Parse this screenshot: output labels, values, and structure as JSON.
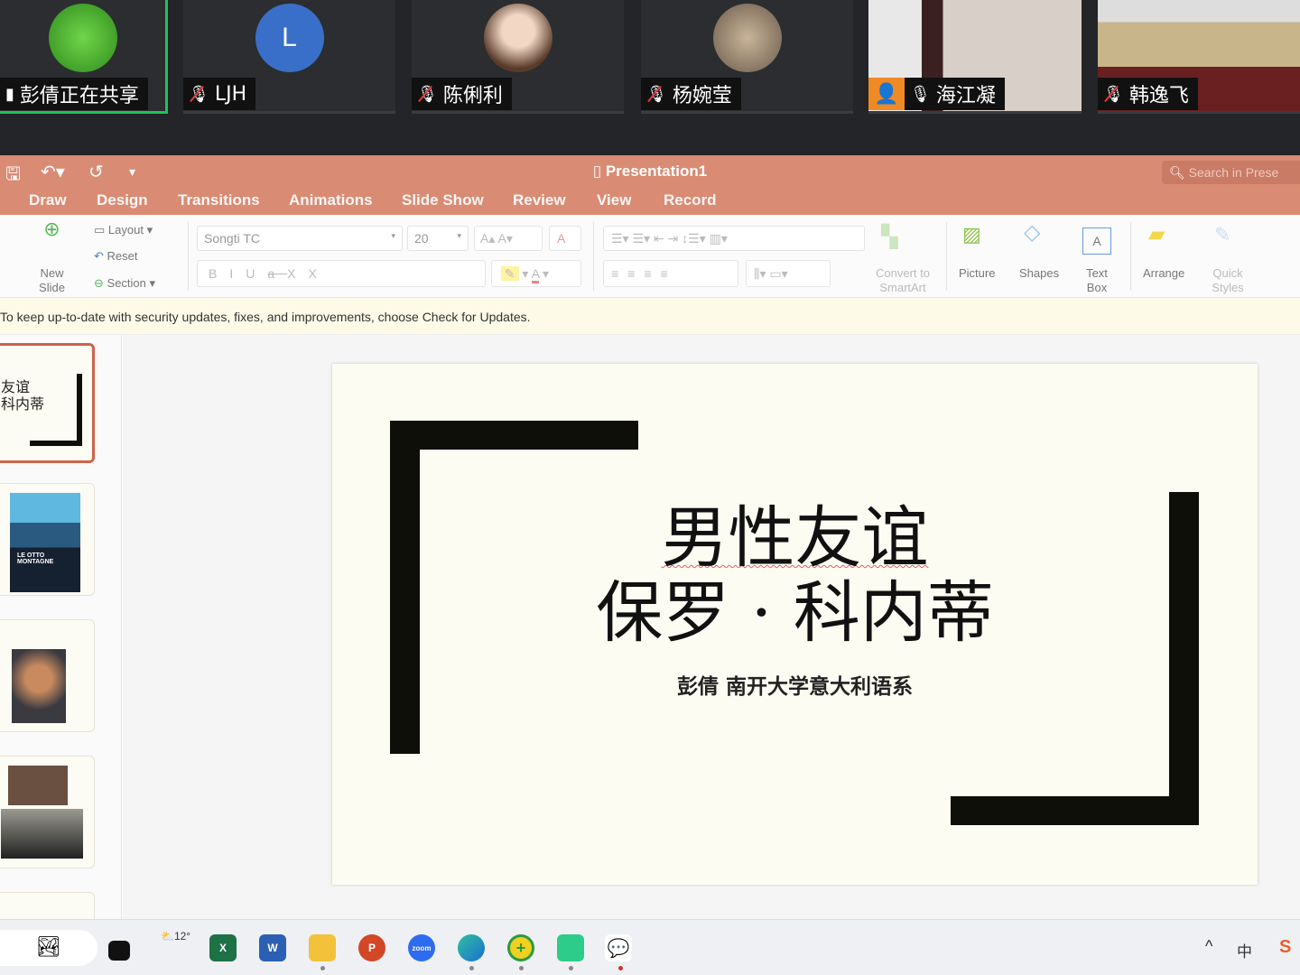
{
  "meeting": {
    "participants": [
      {
        "name": "彭倩正在共享",
        "avatar_color": "#3fae2a",
        "active": true,
        "muted": false
      },
      {
        "name": "LJH",
        "avatar_letter": "L",
        "avatar_color": "#3a6fc9",
        "muted": true
      },
      {
        "name": "陈俐利",
        "avatar_color": "#d9c8bb",
        "muted": true
      },
      {
        "name": "杨婉莹",
        "avatar_color": "#8a7a6a",
        "muted": true
      },
      {
        "name": "海江凝",
        "avatar_color": "#f08a24",
        "muted": false,
        "video": true
      },
      {
        "name": "韩逸飞",
        "avatar_color": "#9a7a5a",
        "muted": true,
        "video": true
      }
    ]
  },
  "app": {
    "title": "Presentation1",
    "search_placeholder": "Search in Prese",
    "accent": "#d98b73",
    "tabs": [
      "Draw",
      "Design",
      "Transitions",
      "Animations",
      "Slide Show",
      "Review",
      "View",
      "Record"
    ]
  },
  "ribbon": {
    "new_slide": "New Slide",
    "layout": "Layout",
    "reset": "Reset",
    "section": "Section",
    "font": "Songti TC",
    "size": "20",
    "convert": "Convert to SmartArt",
    "picture": "Picture",
    "shapes": "Shapes",
    "textbox": "Text Box",
    "arrange": "Arrange",
    "quick_styles": "Quick Styles"
  },
  "notice": "To keep up-to-date with security updates, fixes, and improvements, choose Check for Updates.",
  "thumbnails": {
    "t1_line1": "友谊",
    "t1_line2": "科内蒂",
    "t2_book": "LE OTTO MONTAGNE"
  },
  "slide": {
    "title_line1": "男性友谊",
    "title_line2": "保罗 · 科内蒂",
    "subtitle": "彭倩 南开大学意大利语系"
  },
  "taskbar": {
    "weather": "12°",
    "ime": "中"
  }
}
